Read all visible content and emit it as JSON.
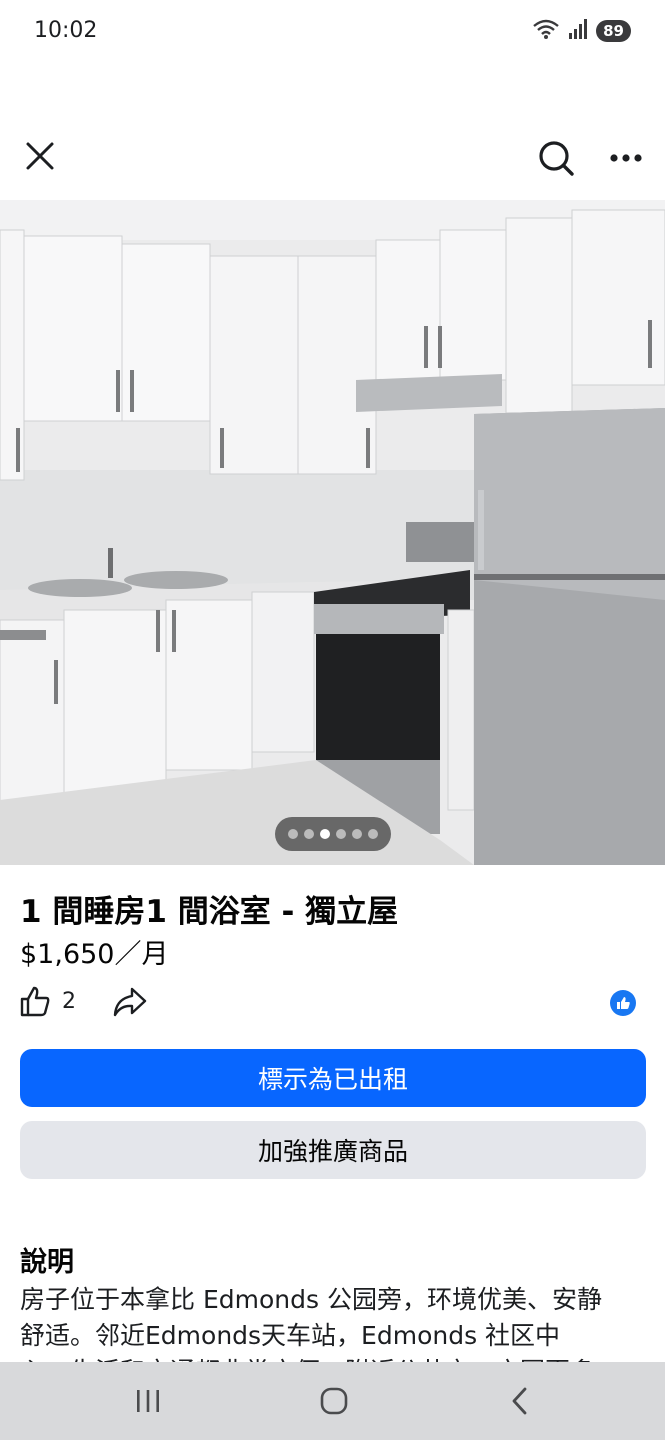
{
  "status_bar": {
    "time": "10:02",
    "battery": "89",
    "icons": [
      "wifi-icon",
      "signal-icon",
      "battery-icon"
    ]
  },
  "toolbar": {
    "close_icon": "close-icon",
    "search_icon": "search-icon",
    "more_icon": "more-icon"
  },
  "photo": {
    "dot_count": 6,
    "active_dot": 3
  },
  "listing": {
    "title": "1 間睡房1 間浴室 - 獨立屋",
    "price": "$1,650／月",
    "like_count": "2"
  },
  "buttons": {
    "mark_rented": "標示為已出租",
    "boost": "加強推廣商品"
  },
  "description": {
    "heading": "說明",
    "lines": [
      "房子位于本拿比 Edmonds 公园旁，环境优美、安静",
      "舒适。邻近Edmonds天车站，Edmonds 社区中",
      "心，生活和交通都非常方便，附近公共交，方圆更多"
    ]
  },
  "colors": {
    "primary": "#0866ff",
    "secondary_bg": "#e4e6eb",
    "reaction": "#1877f2"
  }
}
